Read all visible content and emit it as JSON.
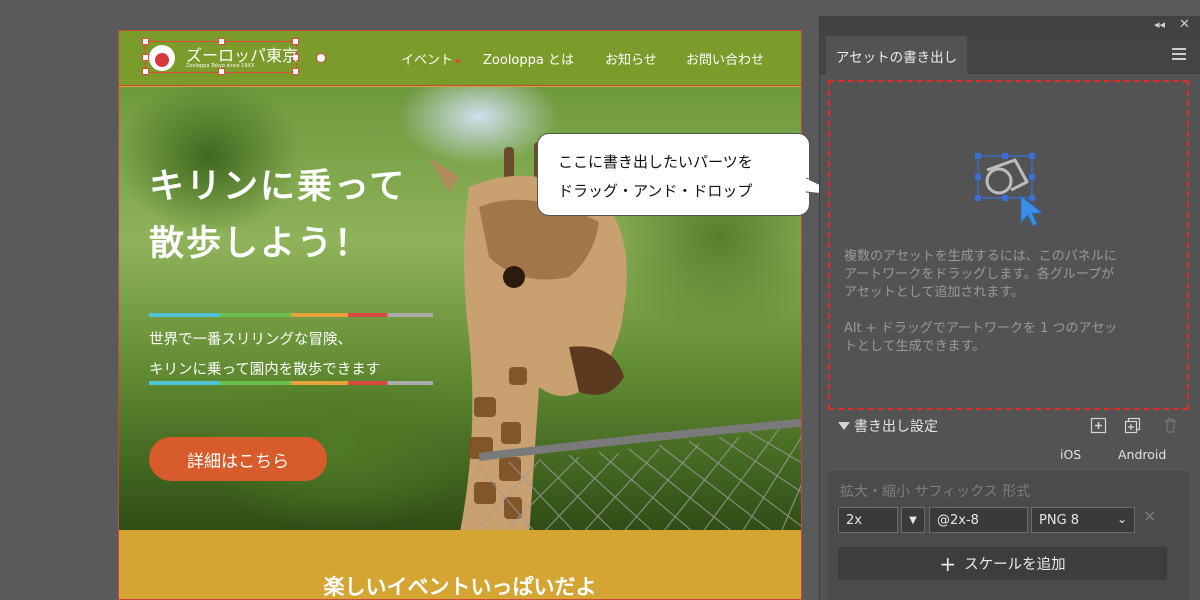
{
  "site": {
    "logo_name": "ズーロッパ東京",
    "logo_sub": "Zooloppa Tokyo since 19XX",
    "nav": [
      "イベント",
      "Zooloppa とは",
      "お知らせ",
      "お問い合わせ"
    ],
    "hero_title": "キリンに乗って\n散歩しよう！",
    "hero_lead": "世界で一番スリリングな冒険、\nキリンに乗って園内を散歩できます",
    "cta_label": "詳細はこちら",
    "events_title": "楽しいイベントいっぱいだよ"
  },
  "callout": {
    "text": "ここに書き出したいパーツを\nドラッグ・アンド・ドロップ"
  },
  "panel": {
    "tab_label": "アセットの書き出し",
    "drop_text_1": "複数のアセットを生成するには、このパネルに\nアートワークをドラッグします。各グループが\nアセットとして追加されます。",
    "drop_text_2": "Alt + ドラッグでアートワークを 1 つのアセッ\nトとして生成できます。",
    "section_title": "書き出し設定",
    "col_ios": "iOS",
    "col_android": "Android",
    "settings_headers": "拡大・縮小  サフィックス  形式",
    "scale_value": "2x",
    "suffix_value": "@2x-8",
    "format_value": "PNG 8",
    "add_scale_label": "スケールを追加",
    "add_scale_plus": "+"
  },
  "colors": {
    "header_green": "#7b9c2a",
    "cta_orange": "#d75b2b",
    "events_gold": "#d4a532",
    "dropzone_border": "#e02b2b",
    "panel_bg": "#535353"
  }
}
